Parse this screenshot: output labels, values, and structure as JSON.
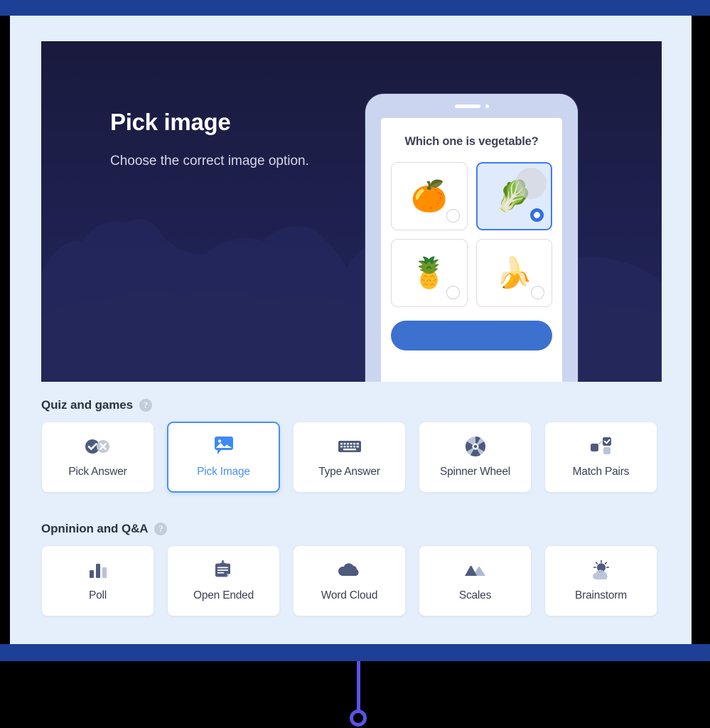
{
  "hero": {
    "title": "Pick image",
    "subtitle": "Choose the correct image option.",
    "phone": {
      "question": "Which one is vegetable?",
      "options": [
        {
          "emoji": "🍊",
          "name": "orange",
          "selected": false
        },
        {
          "emoji": "🥬",
          "name": "cabbage",
          "selected": true
        },
        {
          "emoji": "🍍",
          "name": "pineapple",
          "selected": false
        },
        {
          "emoji": "🍌",
          "name": "bananas",
          "selected": false
        }
      ],
      "submit_label": ""
    }
  },
  "sections": [
    {
      "title": "Quiz and games",
      "help": "?",
      "cards": [
        {
          "label": "Pick Answer",
          "icon": "check-cross-icon",
          "active": false
        },
        {
          "label": "Pick Image",
          "icon": "image-bubble-icon",
          "active": true
        },
        {
          "label": "Type Answer",
          "icon": "keyboard-icon",
          "active": false
        },
        {
          "label": "Spinner Wheel",
          "icon": "spinner-wheel-icon",
          "active": false
        },
        {
          "label": "Match Pairs",
          "icon": "match-pairs-icon",
          "active": false
        }
      ]
    },
    {
      "title": "Opninion and Q&A",
      "help": "?",
      "cards": [
        {
          "label": "Poll",
          "icon": "bar-chart-icon",
          "active": false
        },
        {
          "label": "Open Ended",
          "icon": "form-card-icon",
          "active": false
        },
        {
          "label": "Word Cloud",
          "icon": "cloud-icon",
          "active": false
        },
        {
          "label": "Scales",
          "icon": "mountains-icon",
          "active": false
        },
        {
          "label": "Brainstorm",
          "icon": "lightbulb-cloud-icon",
          "active": false
        }
      ]
    }
  ],
  "colors": {
    "chrome_blue": "#1d4096",
    "panel_bg": "#e4effb",
    "hero_navy": "#1e2150",
    "accent_blue": "#4a90f4",
    "icon_slate": "#4f5b7e",
    "icon_slate_light": "#aeb8d2",
    "pointer_purple": "#5b52e8"
  }
}
